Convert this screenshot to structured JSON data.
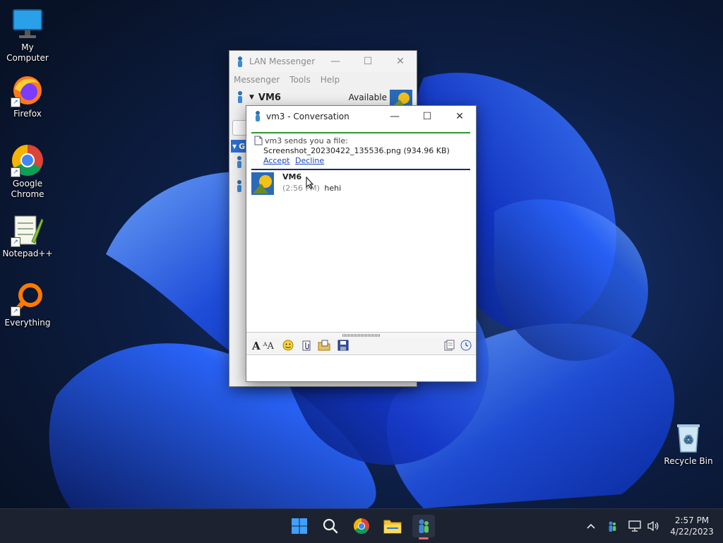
{
  "desktop": {
    "icons": [
      {
        "label": "My Computer",
        "icon": "monitor-icon"
      },
      {
        "label": "Firefox",
        "icon": "firefox-icon"
      },
      {
        "label": "Google Chrome",
        "icon": "chrome-icon"
      },
      {
        "label": "Notepad++",
        "icon": "notepad-plus-plus-icon"
      },
      {
        "label": "Everything",
        "icon": "magnifier-everything-icon"
      },
      {
        "label": "Recycle Bin",
        "icon": "recycle-bin-icon"
      }
    ]
  },
  "main_window": {
    "title": "LAN Messenger",
    "menu": [
      "Messenger",
      "Tools",
      "Help"
    ],
    "user_name": "VM6",
    "status": "Available",
    "group_initial": "G"
  },
  "conversation": {
    "title": "vm3 - Conversation",
    "file_notice": {
      "text": "vm3 sends you a file:",
      "filename": "Screenshot_20230422_135536.png (934.96 KB)",
      "accept": "Accept",
      "decline": "Decline"
    },
    "message": {
      "sender": "VM6",
      "time": "(2:56 PM)",
      "text": "hehi"
    },
    "toolbar_icons": [
      "font-icon",
      "font-style-icon",
      "smiley-icon",
      "attach-file-icon",
      "send-folder-icon",
      "save-icon",
      "history-icon",
      "clock-icon"
    ]
  },
  "taskbar": {
    "time": "2:57 PM",
    "date": "4/22/2023"
  },
  "colors": {
    "accent_green": "#2e9a2e",
    "accent_navy": "#1a2a6c",
    "link": "#1a48c4",
    "taskbar": "#1c2230"
  }
}
